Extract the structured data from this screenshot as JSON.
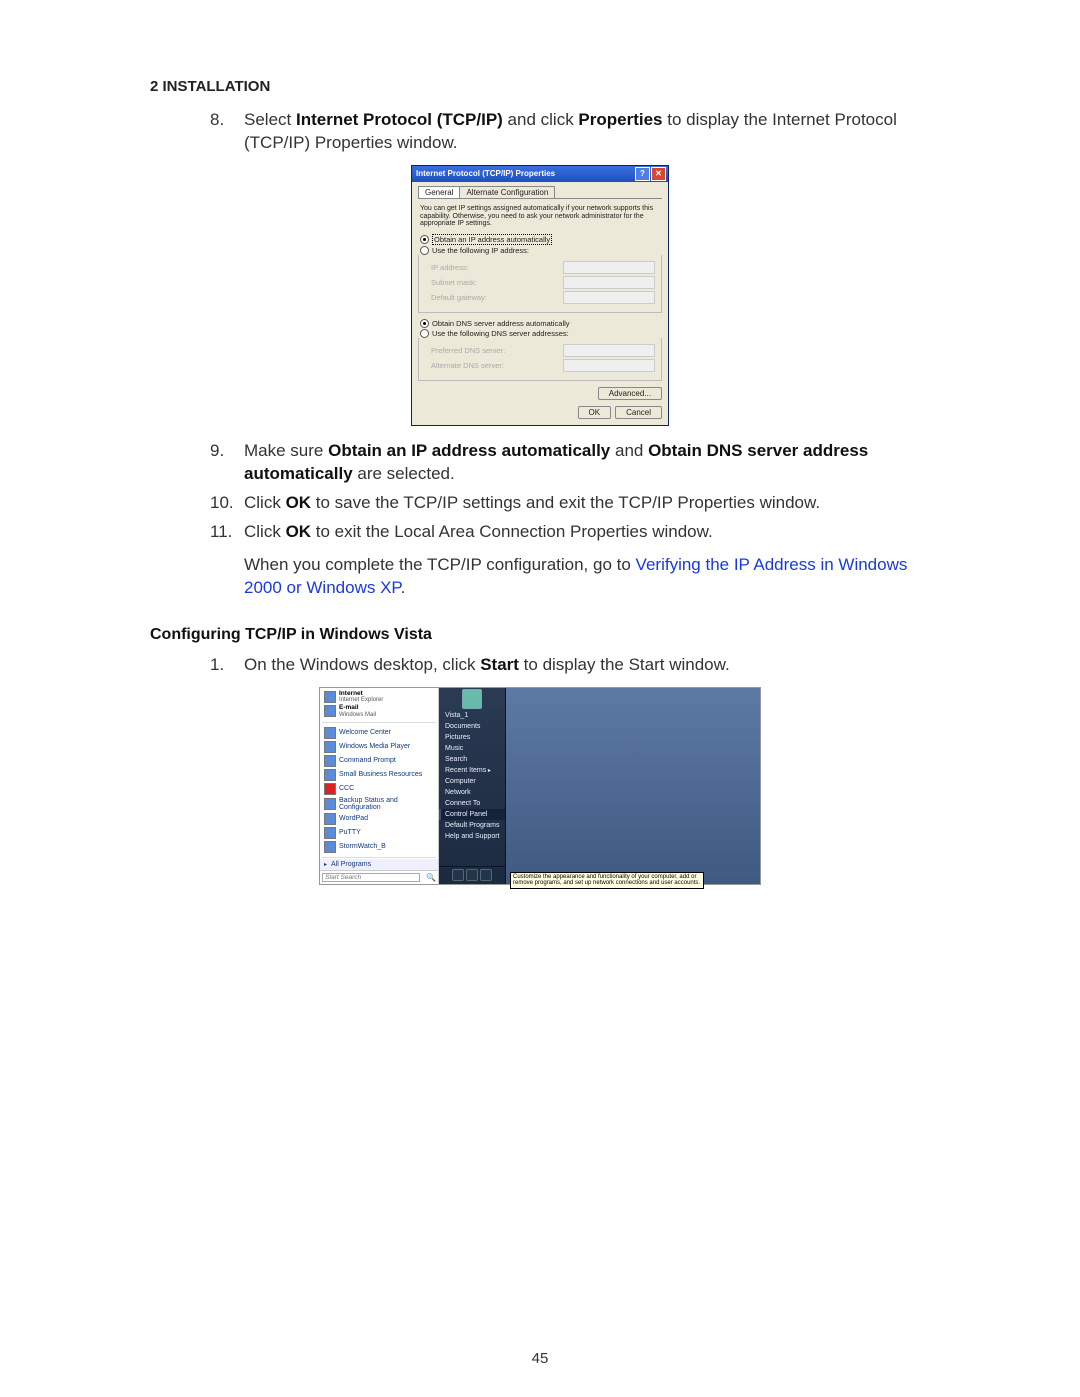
{
  "header": "2 INSTALLATION",
  "steps_a": [
    {
      "n": "8.",
      "pre": "Select ",
      "b1": "Internet Protocol (TCP/IP)",
      "mid": " and click ",
      "b2": "Properties",
      "post": " to display the Internet Protocol (TCP/IP) Properties window."
    }
  ],
  "tcpip": {
    "title": "Internet Protocol (TCP/IP) Properties",
    "help_btn": "?",
    "close_btn": "✕",
    "tab_general": "General",
    "tab_alt": "Alternate Configuration",
    "desc": "You can get IP settings assigned automatically if your network supports this capability. Otherwise, you need to ask your network administrator for the appropriate IP settings.",
    "r_ip_auto": "Obtain an IP address automatically",
    "r_ip_manual": "Use the following IP address:",
    "f_ip": "IP address:",
    "f_mask": "Subnet mask:",
    "f_gw": "Default gateway:",
    "r_dns_auto": "Obtain DNS server address automatically",
    "r_dns_manual": "Use the following DNS server addresses:",
    "f_dns1": "Preferred DNS server:",
    "f_dns2": "Alternate DNS server:",
    "btn_adv": "Advanced...",
    "btn_ok": "OK",
    "btn_cancel": "Cancel"
  },
  "steps_b": [
    {
      "n": "9.",
      "pre": "Make sure ",
      "b1": "Obtain an IP address automatically",
      "mid": " and ",
      "b2": "Obtain DNS server address automatically",
      "post": " are selected."
    },
    {
      "n": "10.",
      "pre": "Click ",
      "b1": "OK",
      "mid": " to save the TCP/IP settings and exit the TCP/IP Properties window.",
      "b2": "",
      "post": ""
    },
    {
      "n": "11.",
      "pre": "Click ",
      "b1": "OK",
      "mid": " to exit the Local Area Connection Properties window.",
      "b2": "",
      "post": ""
    }
  ],
  "after_list_pre": "When you complete the TCP/IP configuration, go to ",
  "after_list_link": "Verifying the IP Address in Windows 2000 or Windows XP",
  "after_list_post": ".",
  "subheading": "Configuring TCP/IP in Windows Vista",
  "steps_c": [
    {
      "n": "1.",
      "pre": "On the Windows desktop, click ",
      "b1": "Start",
      "mid": " to display the Start window.",
      "b2": "",
      "post": ""
    }
  ],
  "vista": {
    "pinned": [
      {
        "t1": "Internet",
        "t2": "Internet Explorer"
      },
      {
        "t1": "E-mail",
        "t2": "Windows Mail"
      }
    ],
    "recent": [
      "Welcome Center",
      "Windows Media Player",
      "Command Prompt",
      "Small Business Resources",
      "CCC",
      "Backup Status and Configuration",
      "WordPad",
      "PuTTY",
      "StormWatch_B"
    ],
    "all_programs": "All Programs",
    "search_placeholder": "Start Search",
    "user": "Vista_1",
    "mid_items": [
      {
        "label": "Documents"
      },
      {
        "label": "Pictures"
      },
      {
        "label": "Music"
      },
      {
        "label": "Search"
      },
      {
        "label": "Recent Items",
        "arrow": true
      },
      {
        "label": "Computer"
      },
      {
        "label": "Network"
      },
      {
        "label": "Connect To"
      },
      {
        "label": "Control Panel",
        "hl": true
      },
      {
        "label": "Default Programs"
      },
      {
        "label": "Help and Support"
      }
    ],
    "tooltip": "Customize the appearance and functionality of your computer, add or remove programs, and set up network connections and user accounts."
  },
  "page_number": "45"
}
